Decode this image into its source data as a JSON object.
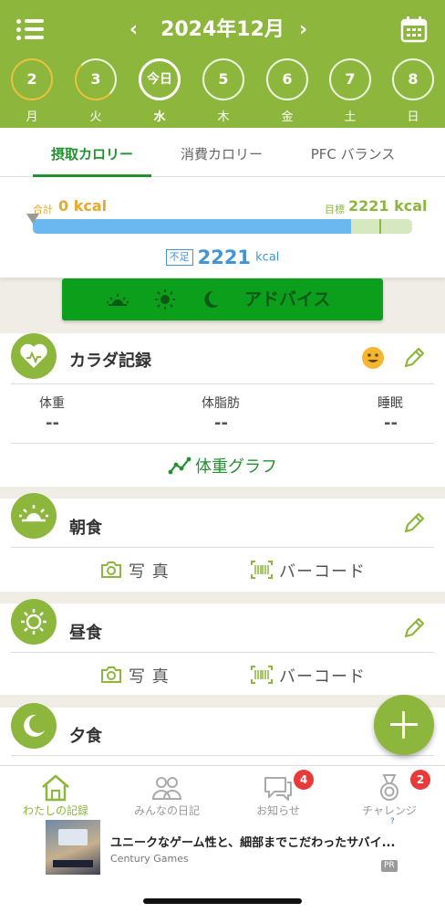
{
  "colors": {
    "brand": "#8cb63c",
    "tab_active": "#22912f",
    "advice": "#0c9f1c",
    "consumed": "#e8a82c",
    "shortage": "#3f95d8",
    "badge": "#e93a3a"
  },
  "header": {
    "menu_icon": "list-menu-icon",
    "month_title": "2024年12月",
    "prev": "‹",
    "next": "›",
    "calendar_icon": "calendar-icon",
    "days": [
      {
        "num": "2",
        "weekday": "月"
      },
      {
        "num": "3",
        "weekday": "火"
      },
      {
        "num": "今日",
        "weekday": "水"
      },
      {
        "num": "5",
        "weekday": "木"
      },
      {
        "num": "6",
        "weekday": "金"
      },
      {
        "num": "7",
        "weekday": "土"
      },
      {
        "num": "8",
        "weekday": "日"
      }
    ]
  },
  "tabs": [
    "摂取カロリー",
    "消費カロリー",
    "PFC バランス"
  ],
  "active_tab": 0,
  "kcal": {
    "total_label": "合計",
    "total_value": "0 kcal",
    "goal_label": "目標",
    "goal_value": "2221 kcal",
    "short_label": "不足",
    "short_value": "2221",
    "short_unit": "kcal",
    "consumed_fraction": 0.84
  },
  "advice": {
    "label": "アドバイス",
    "icons": [
      "sunrise-icon",
      "sun-icon",
      "moon-icon"
    ]
  },
  "body_record": {
    "title": "カラダ記録",
    "stats": [
      {
        "label": "体重",
        "value": "--"
      },
      {
        "label": "体脂肪",
        "value": "--"
      },
      {
        "label": "睡眠",
        "value": "--"
      }
    ],
    "graph_link": "体重グラフ"
  },
  "meals": [
    {
      "title": "朝食",
      "icon": "sunrise-icon",
      "photo_label": "写 真",
      "barcode_label": "バーコード"
    },
    {
      "title": "昼食",
      "icon": "sun-icon",
      "photo_label": "写 真",
      "barcode_label": "バーコード"
    },
    {
      "title": "夕食",
      "icon": "moon-icon"
    }
  ],
  "fab": "plus-icon",
  "nav": [
    {
      "label": "わたしの記録",
      "icon": "home-icon",
      "badge": ""
    },
    {
      "label": "みんなの日記",
      "icon": "people-icon",
      "badge": ""
    },
    {
      "label": "お知らせ",
      "icon": "chat-bubble-icon",
      "badge": "4"
    },
    {
      "label": "チャレンジ",
      "icon": "medal-icon",
      "badge": "2"
    }
  ],
  "ad": {
    "title": "ユニークなゲーム性と、細部までこだわったサバイ...",
    "advertiser": "Century Games",
    "pr": "PR",
    "info": "?"
  }
}
